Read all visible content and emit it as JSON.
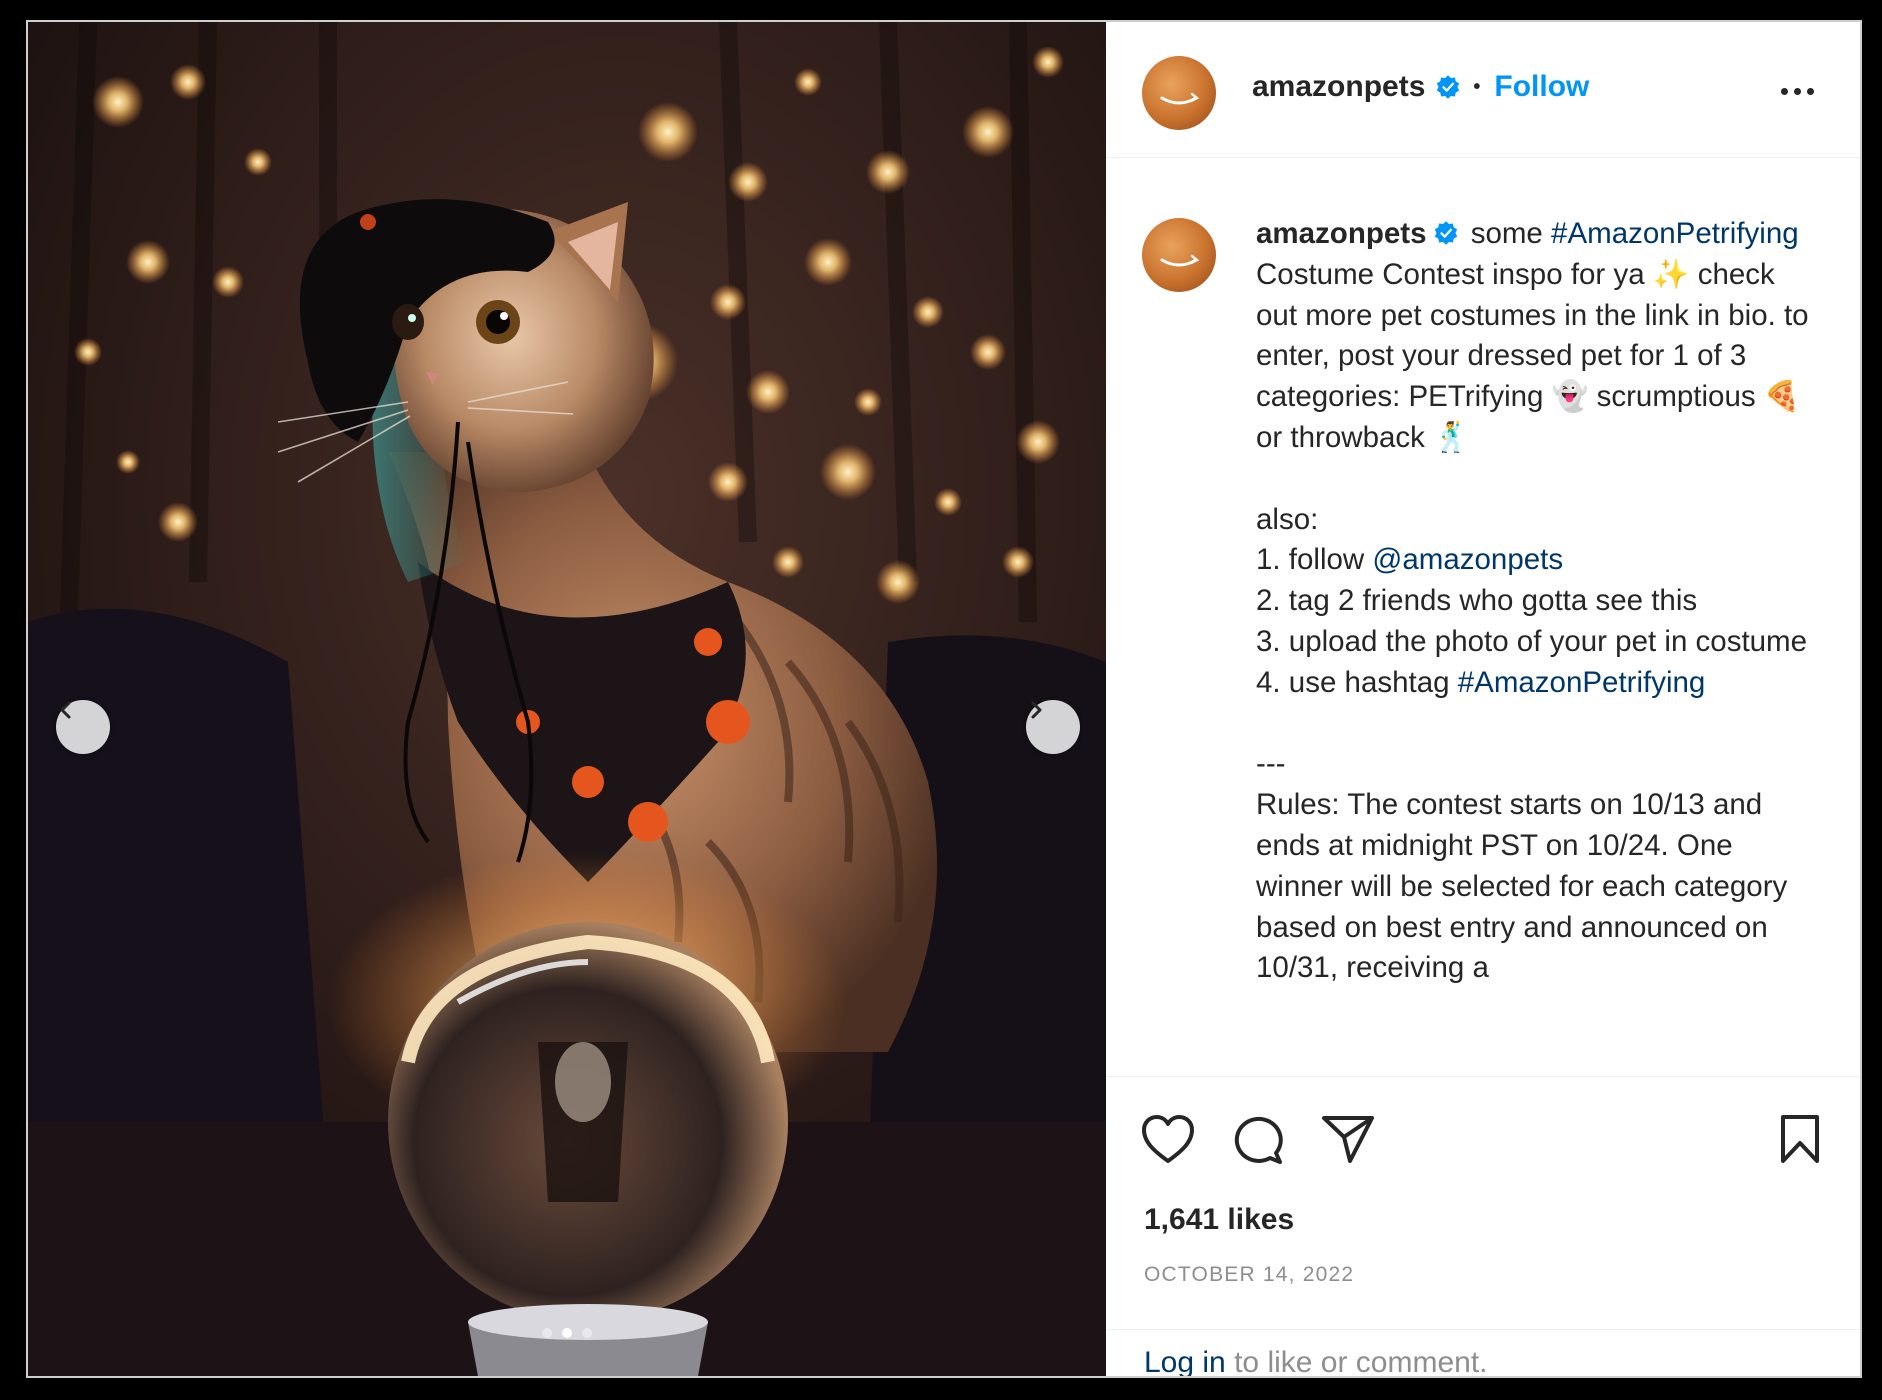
{
  "header": {
    "username": "amazonpets",
    "separator": "•",
    "follow_label": "Follow"
  },
  "caption": {
    "username": "amazonpets",
    "p1": " some ",
    "hashtag1": "#AmazonPetrifying",
    "p2": " Costume Contest inspo for ya ✨ check out more pet costumes in the link in bio. to enter, post your dressed pet for 1 of 3 categories: PETrifying 👻 scrumptious 🍕 or throwback 🕺\n\nalso:\n1. follow ",
    "mention": "@amazonpets",
    "p3": "\n2. tag 2 friends who gotta see this\n3. upload the photo of your pet in costume\n4. use hashtag ",
    "hashtag2": "#AmazonPetrifying",
    "p4": "\n\n---\nRules: The contest starts on 10/13 and ends at midnight PST on 10/24. One winner will be selected for each category based on best entry and announced on 10/31, receiving a"
  },
  "actions": {
    "likes": "1,641 likes",
    "date": "OCTOBER 14, 2022"
  },
  "login": {
    "link": "Log in",
    "rest": " to like or comment."
  },
  "carousel": {
    "slide_count": 3,
    "active_index": 1
  },
  "colors": {
    "follow": "#0095f6",
    "link": "#00376b",
    "verified": "#0095f6",
    "muted": "#8e8e8e",
    "text": "#262626"
  },
  "icons": [
    "chevron-left-icon",
    "chevron-right-icon",
    "verified-badge-icon",
    "more-options-icon",
    "heart-icon",
    "comment-icon",
    "share-icon",
    "bookmark-icon"
  ]
}
